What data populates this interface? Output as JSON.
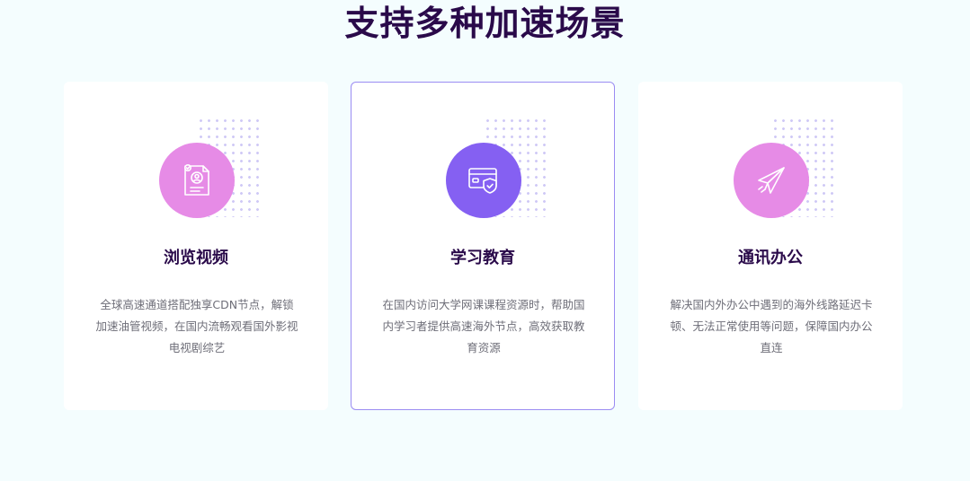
{
  "section": {
    "title": "支持多种加速场景"
  },
  "cards": [
    {
      "title": "浏览视频",
      "description": "全球高速通道搭配独享CDN节点，解锁加速油管视频，在国内流畅观看国外影视电视剧综艺",
      "icon": "video-report-icon",
      "color": "#e68be6",
      "active": false
    },
    {
      "title": "学习教育",
      "description": "在国内访问大学网课课程资源时，帮助国内学习者提供高速海外节点，高效获取教育资源",
      "icon": "secure-card-icon",
      "color": "#8560f2",
      "active": true
    },
    {
      "title": "通讯办公",
      "description": "解决国内外办公中遇到的海外线路延迟卡顿、无法正常使用等问题，保障国内办公直连",
      "icon": "paper-plane-icon",
      "color": "#e68be6",
      "active": false
    }
  ]
}
